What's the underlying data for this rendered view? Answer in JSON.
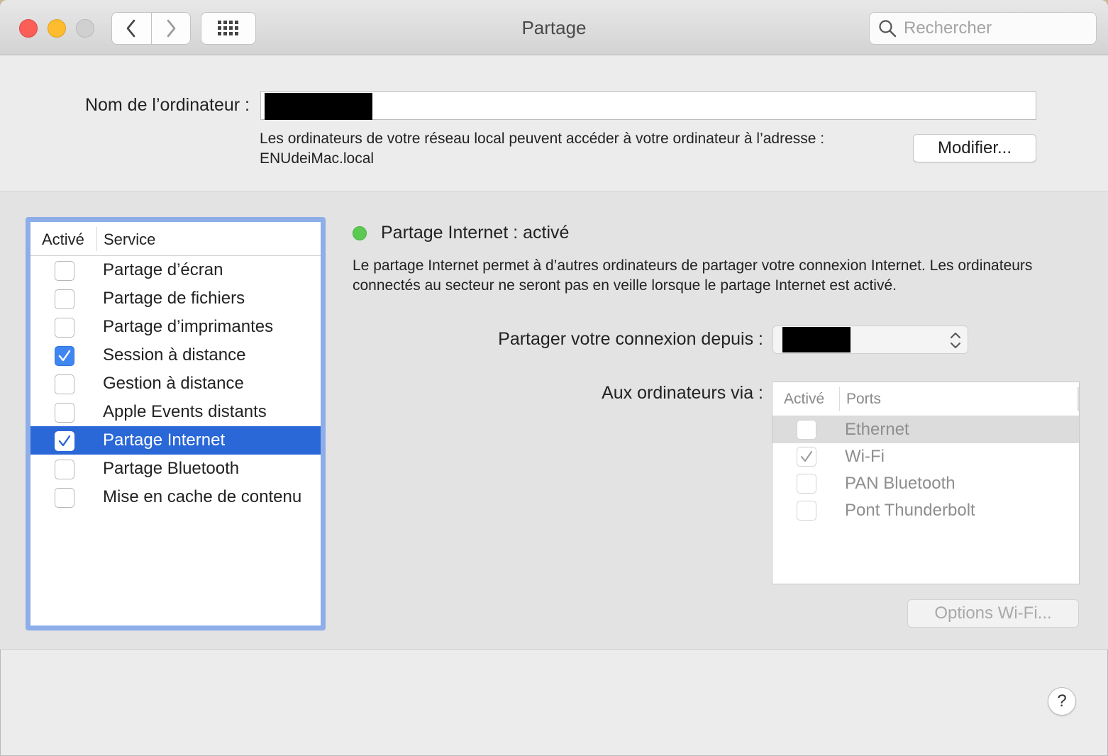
{
  "window": {
    "title": "Partage"
  },
  "toolbar": {
    "back_icon": "chevron-left-icon",
    "forward_icon": "chevron-right-icon",
    "grid_icon": "show-all-grid-icon",
    "search_placeholder": "Rechercher"
  },
  "computer_name": {
    "label": "Nom de l’ordinateur :",
    "value_redacted": true,
    "address_line1": "Les ordinateurs de votre réseau local peuvent accéder à votre ordinateur à l’adresse :",
    "address_line2": "ENUdeiMac.local",
    "modify_button": "Modifier..."
  },
  "services": {
    "header_active": "Activé",
    "header_service": "Service",
    "items": [
      {
        "label": "Partage d’écran",
        "checked": false,
        "selected": false
      },
      {
        "label": "Partage de fichiers",
        "checked": false,
        "selected": false
      },
      {
        "label": "Partage d’imprimantes",
        "checked": false,
        "selected": false
      },
      {
        "label": "Session à distance",
        "checked": true,
        "selected": false
      },
      {
        "label": "Gestion à distance",
        "checked": false,
        "selected": false
      },
      {
        "label": "Apple Events distants",
        "checked": false,
        "selected": false
      },
      {
        "label": "Partage Internet",
        "checked": true,
        "selected": true
      },
      {
        "label": "Partage Bluetooth",
        "checked": false,
        "selected": false
      },
      {
        "label": "Mise en cache de contenu",
        "checked": false,
        "selected": false
      }
    ]
  },
  "detail": {
    "status_title": "Partage Internet : activé",
    "status_color": "#5cc953",
    "description": "Le partage Internet permet à d’autres ordinateurs de partager votre connexion Internet. Les ordinateurs connectés au secteur ne seront pas en veille lorsque le partage Internet est activé.",
    "share_from_label": "Partager votre connexion depuis :",
    "share_from_value_redacted": true,
    "to_computers_label": "Aux ordinateurs via :",
    "ports_header_active": "Activé",
    "ports_header_ports": "Ports",
    "ports": [
      {
        "label": "Ethernet",
        "checked": false,
        "highlight": true
      },
      {
        "label": "Wi-Fi",
        "checked": true,
        "highlight": false
      },
      {
        "label": "PAN Bluetooth",
        "checked": false,
        "highlight": false
      },
      {
        "label": "Pont Thunderbolt",
        "checked": false,
        "highlight": false
      }
    ],
    "wifi_options_button": "Options Wi-Fi..."
  },
  "help_button": "?",
  "colors": {
    "selection": "#2a67d7",
    "focus_ring": "#8daee8",
    "checkbox_checked": "#3f86f2"
  }
}
